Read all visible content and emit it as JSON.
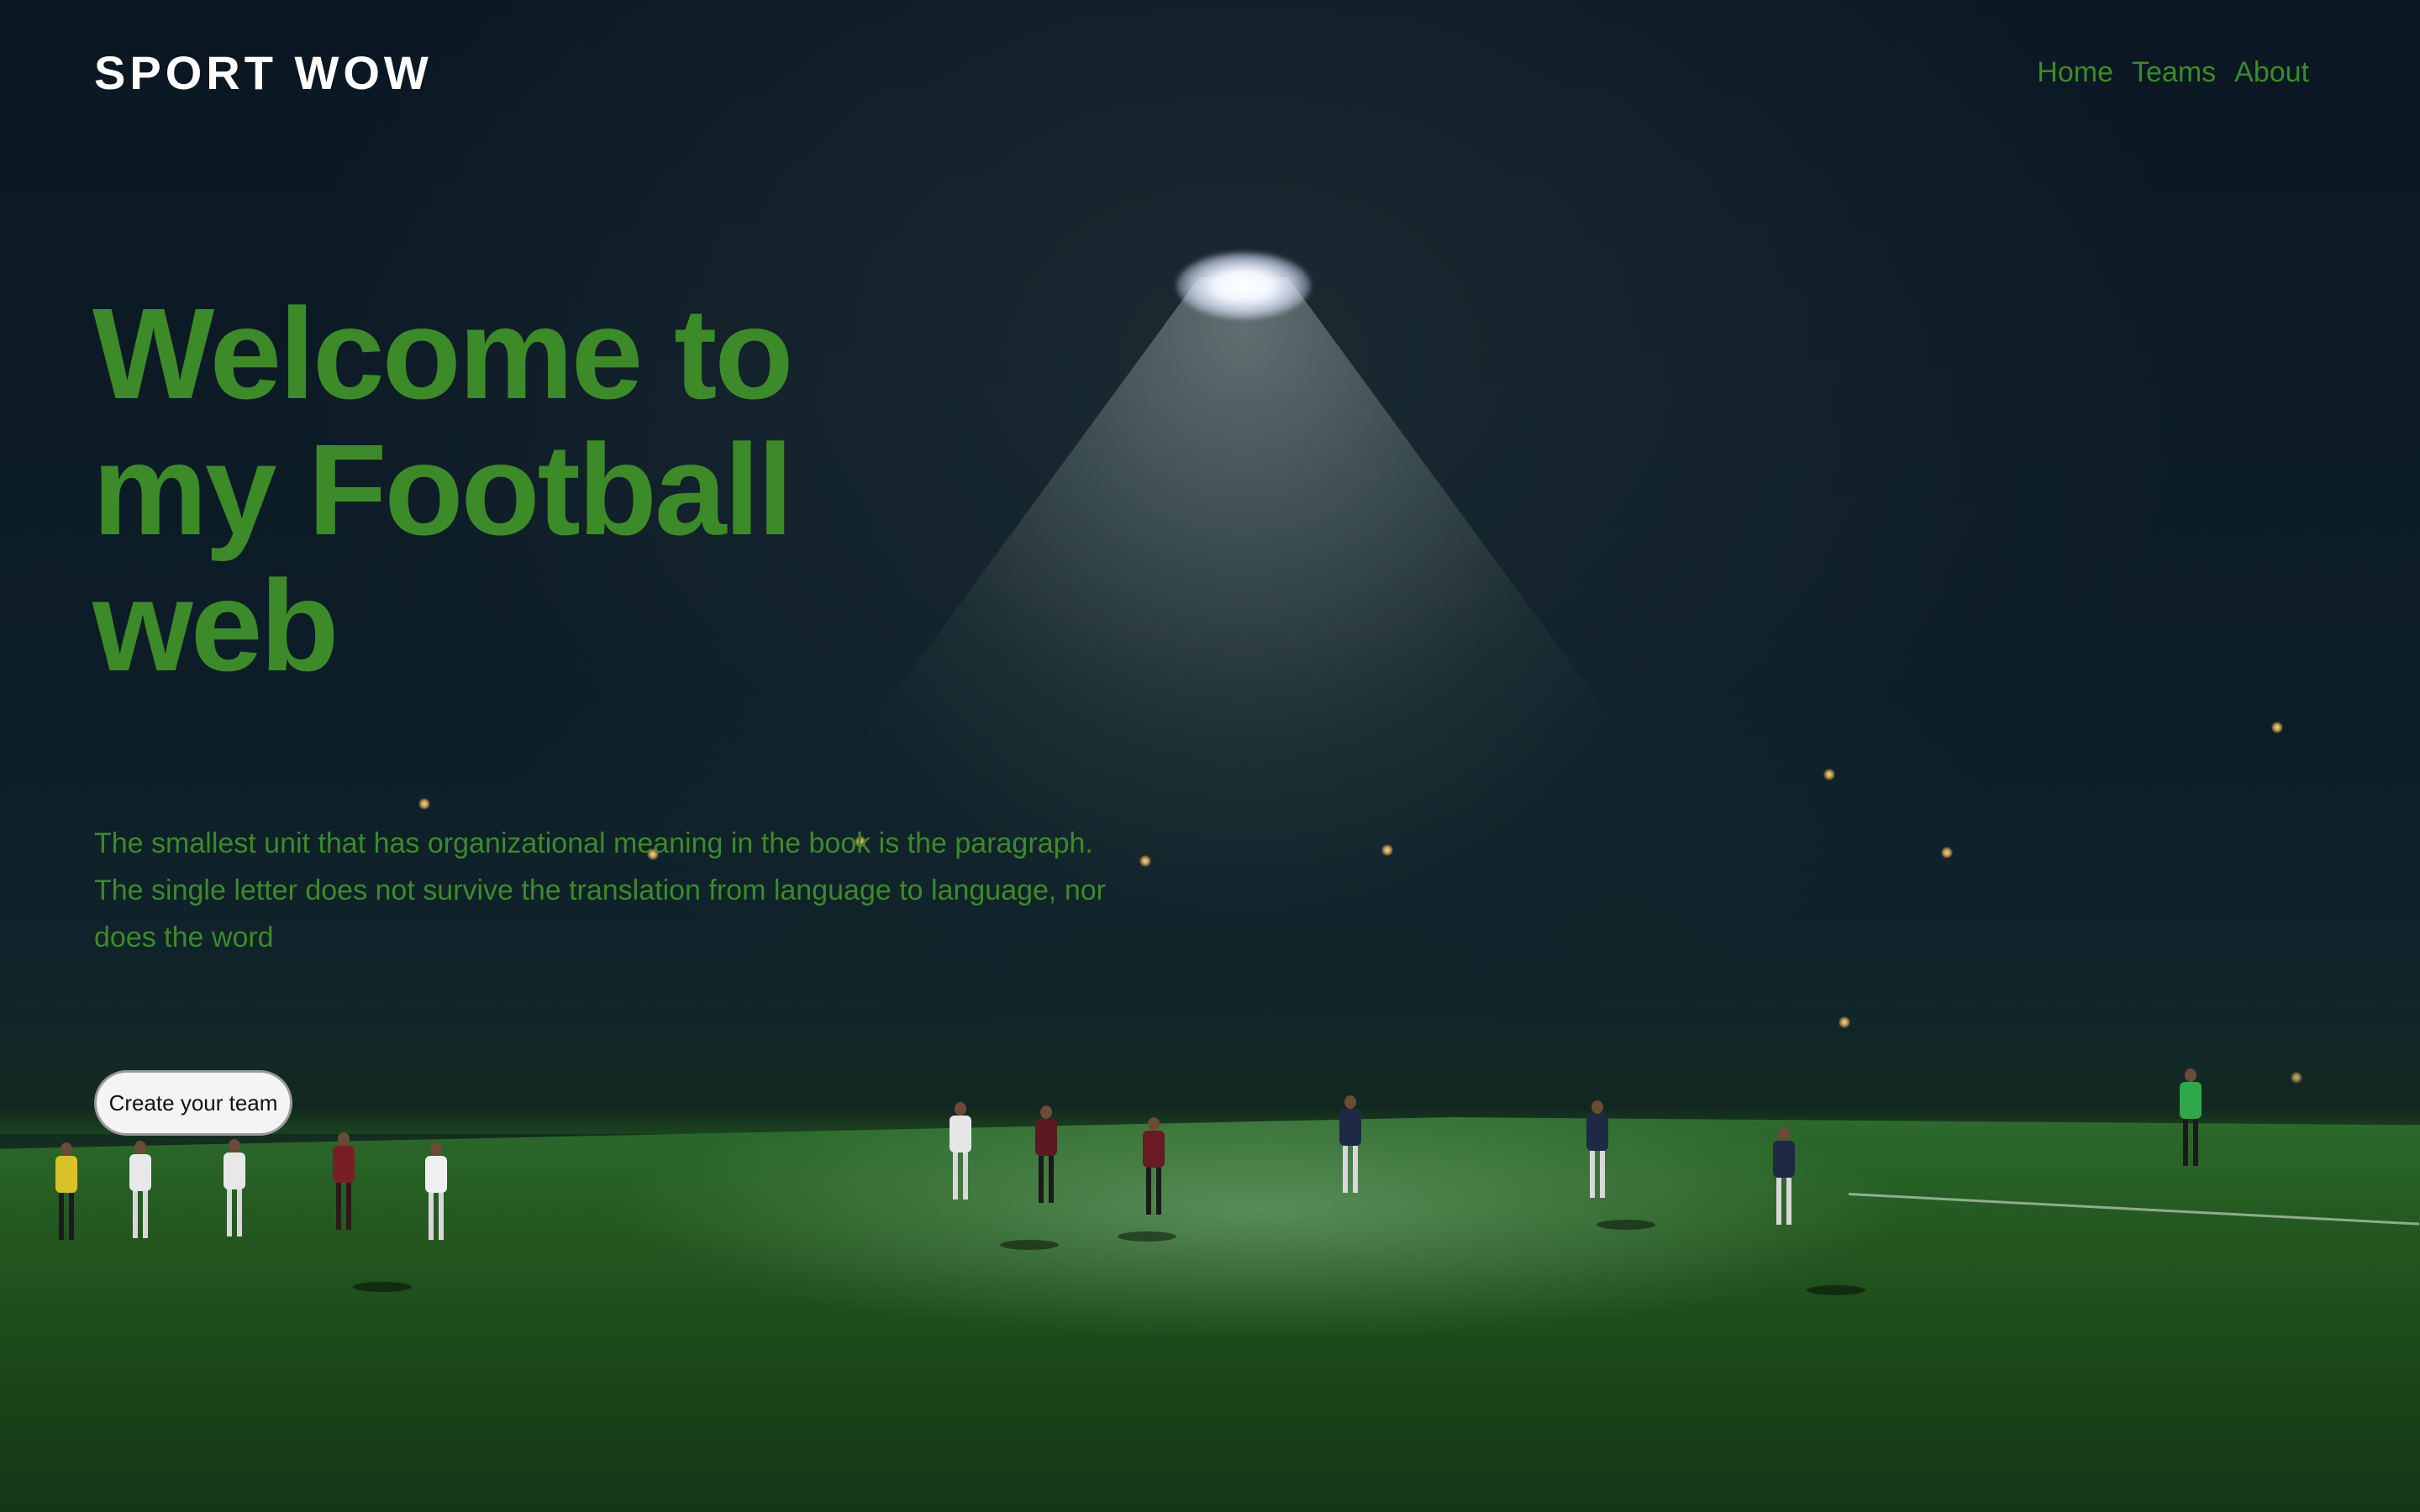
{
  "header": {
    "logo": "SPORT WOW",
    "nav": [
      {
        "label": "Home"
      },
      {
        "label": "Teams"
      },
      {
        "label": "About"
      }
    ]
  },
  "hero": {
    "title": "Welcome to my Football web",
    "description": "The smallest unit that has organizational meaning in the book is the paragraph. The single letter does not survive the translation from language to language, nor does the word",
    "cta_label": "Create your team"
  },
  "colors": {
    "accent": "#3d8a28",
    "background": "#0b1a24",
    "logo": "#ffffff",
    "button_bg": "#f4f4f4"
  },
  "background_image": "night-football-match-photo"
}
